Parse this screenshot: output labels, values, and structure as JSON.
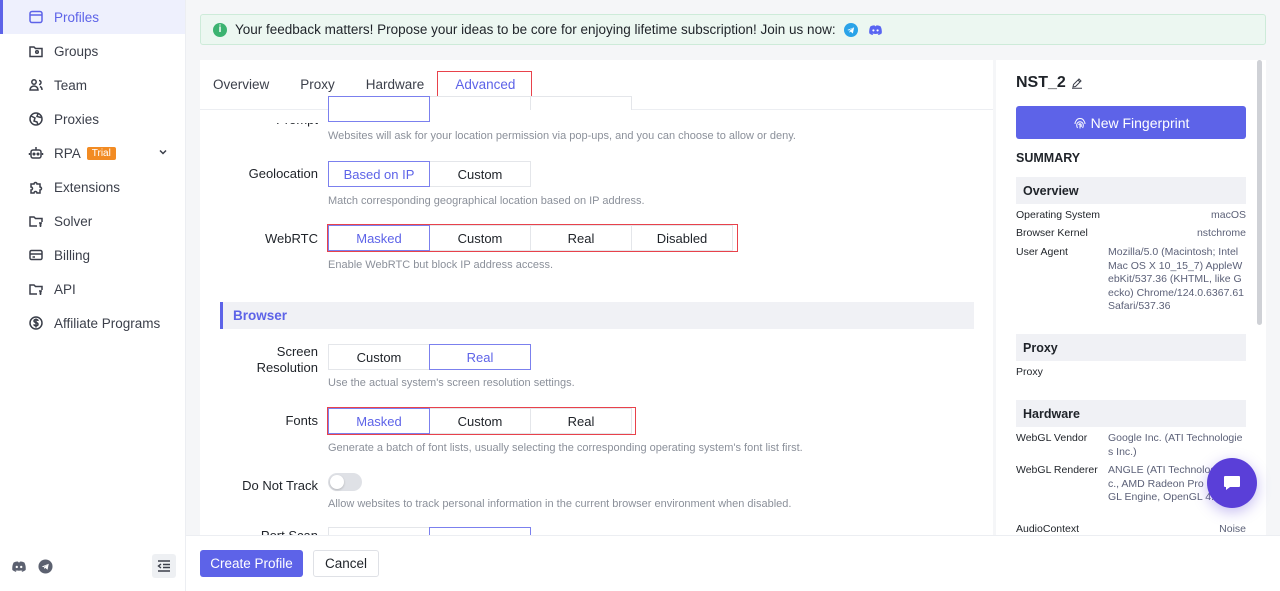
{
  "sidebar": {
    "items": [
      {
        "label": "Profiles",
        "icon": "browser-window-icon",
        "active": true
      },
      {
        "label": "Groups",
        "icon": "folder-user-icon"
      },
      {
        "label": "Team",
        "icon": "team-icon"
      },
      {
        "label": "Proxies",
        "icon": "globe-icon"
      },
      {
        "label": "RPA",
        "icon": "robot-icon",
        "badge": "Trial"
      },
      {
        "label": "Extensions",
        "icon": "puzzle-icon"
      },
      {
        "label": "Solver",
        "icon": "folder-key-icon"
      },
      {
        "label": "Billing",
        "icon": "credit-card-icon"
      },
      {
        "label": "API",
        "icon": "folder-key-icon"
      },
      {
        "label": "Affiliate Programs",
        "icon": "dollar-circle-icon"
      }
    ],
    "footer_icons": [
      "discord-icon",
      "telegram-icon",
      "collapse-menu-icon"
    ]
  },
  "notice": {
    "text": "Your feedback matters! Propose your ideas to be core for enjoying lifetime subscription! Join us now:"
  },
  "tabs": [
    {
      "label": "Overview"
    },
    {
      "label": "Proxy"
    },
    {
      "label": "Hardware"
    },
    {
      "label": "Advanced",
      "active": true
    }
  ],
  "advanced": {
    "prompt_label": "Prompt",
    "prompt_hint": "Websites will ask for your location permission via pop-ups, and you can choose to allow or deny.",
    "geolocation": {
      "label": "Geolocation",
      "options": [
        "Based on IP",
        "Custom"
      ],
      "selected": "Based on IP",
      "hint": "Match corresponding geographical location based on IP address."
    },
    "webrtc": {
      "label": "WebRTC",
      "options": [
        "Masked",
        "Custom",
        "Real",
        "Disabled"
      ],
      "selected": "Masked",
      "hint": "Enable WebRTC but block IP address access."
    },
    "browser_section": "Browser",
    "screen_resolution": {
      "label_line1": "Screen",
      "label_line2": "Resolution",
      "options": [
        "Custom",
        "Real"
      ],
      "selected": "Real",
      "hint": "Use the actual system's screen resolution settings."
    },
    "fonts": {
      "label": "Fonts",
      "options": [
        "Masked",
        "Custom",
        "Real"
      ],
      "selected": "Masked",
      "hint": "Generate a batch of font lists, usually selecting the corresponding operating system's font list first."
    },
    "do_not_track": {
      "label": "Do Not Track",
      "enabled": false,
      "hint": "Allow websites to track personal information in the current browser environment when disabled."
    },
    "port_scan_label": "Port Scan"
  },
  "summary": {
    "profile_name": "NST_2",
    "new_fingerprint_label": "New Fingerprint",
    "title": "SUMMARY",
    "overview": {
      "heading": "Overview",
      "os_key": "Operating System",
      "os_val": "macOS",
      "kernel_key": "Browser Kernel",
      "kernel_val": "nstchrome",
      "ua_key": "User Agent",
      "ua_val": "Mozilla/5.0 (Macintosh; Intel Mac OS X 10_15_7) AppleWebKit/537.36 (KHTML, like Gecko) Chrome/124.0.6367.61 Safari/537.36"
    },
    "proxy": {
      "heading": "Proxy",
      "key": "Proxy"
    },
    "hardware": {
      "heading": "Hardware",
      "vendor_key": "WebGL Vendor",
      "vendor_val": "Google Inc. (ATI Technologies Inc.)",
      "renderer_key": "WebGL Renderer",
      "renderer_val": "ANGLE (ATI Technologies Inc., AMD Radeon Pro ... OpenGL Engine, OpenGL 4.1)",
      "audio_key": "AudioContext",
      "audio_val": "Noise"
    }
  },
  "footer": {
    "create_label": "Create Profile",
    "cancel_label": "Cancel"
  },
  "colors": {
    "accent": "#5d63e8",
    "highlight_red": "#e8424b",
    "trial_badge": "#f28b23",
    "chat_fab": "#5a3fd8"
  }
}
